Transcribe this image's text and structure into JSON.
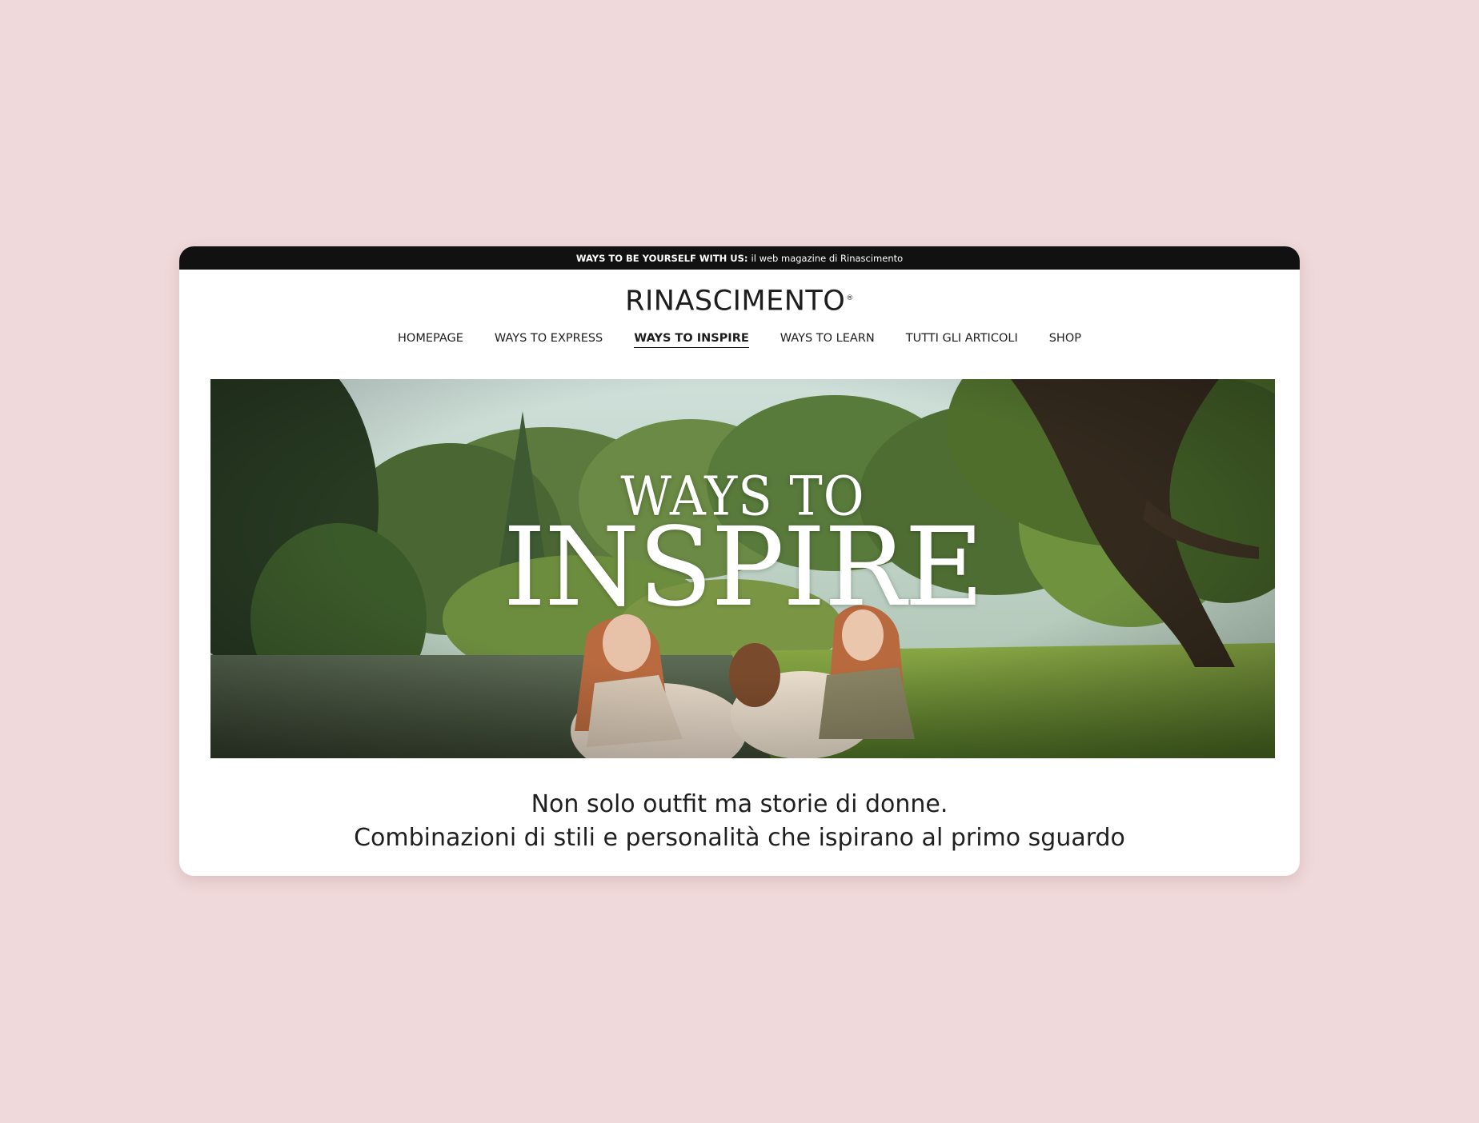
{
  "topbar": {
    "strong": "WAYS TO BE YOURSELF WITH US:",
    "text": "il web magazine di Rinascimento"
  },
  "logo": {
    "text": "RINASCIMENTO",
    "mark": "®"
  },
  "nav": {
    "items": [
      {
        "label": "HOMEPAGE"
      },
      {
        "label": "WAYS TO EXPRESS"
      },
      {
        "label": "WAYS TO INSPIRE",
        "active": true
      },
      {
        "label": "WAYS TO LEARN"
      },
      {
        "label": "TUTTI GLI ARTICOLI"
      },
      {
        "label": "SHOP"
      }
    ]
  },
  "hero": {
    "title_top": "WAYS TO",
    "title_main": "INSPIRE"
  },
  "tagline": {
    "line1": "Non solo outfit ma storie di donne.",
    "line2": "Combinazioni di stili e personalità che ispirano al primo sguardo"
  },
  "colors": {
    "background": "#f0d9da",
    "topbar": "#111111",
    "text": "#1d1d1d"
  }
}
